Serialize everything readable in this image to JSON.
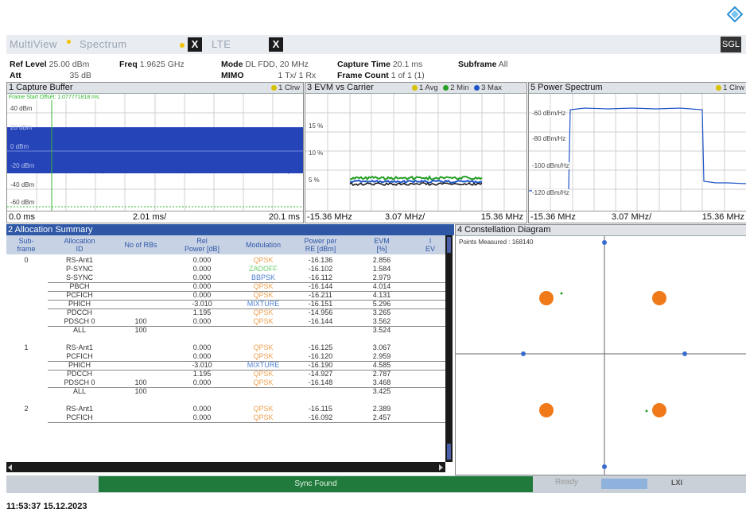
{
  "tabs": {
    "multiview": "MultiView",
    "spectrum": "Spectrum",
    "lte": "LTE",
    "close": "X",
    "mode": "SGL"
  },
  "info": {
    "ref_level_label": "Ref Level",
    "ref_level_value": "25.00 dBm",
    "freq_label": "Freq",
    "freq_value": "1.9625 GHz",
    "mode_label": "Mode",
    "mode_value": "DL FDD, 20 MHz",
    "capture_time_label": "Capture Time",
    "capture_time_value": "20.1 ms",
    "subframe_label": "Subframe",
    "subframe_value": "All",
    "att_label": "Att",
    "att_value": "35 dB",
    "mimo_label": "MIMO",
    "mimo_value": "1 Tx/ 1 Rx",
    "frame_count_label": "Frame Count",
    "frame_count_value": "1 of 1 (1)"
  },
  "capture": {
    "title": "1 Capture Buffer",
    "trace": "1 Clrw",
    "marker_note": "Frame Start Offset: 1.077771818 ms",
    "y_labels": [
      "40 dBm",
      "20 dBm",
      "0 dBm",
      "-20 dBm",
      "-40 dBm",
      "-60 dBm"
    ],
    "x_start": "0.0 ms",
    "x_div": "2.01 ms/",
    "x_end": "20.1 ms"
  },
  "evm": {
    "title": "3 EVM vs Carrier",
    "trace1": "1 Avg",
    "trace2": "2 Min",
    "trace3": "3 Max",
    "y_labels": [
      "15 %",
      "10 %",
      "5 %"
    ],
    "x_start": "-15.36 MHz",
    "x_div": "3.07 MHz/",
    "x_end": "15.36 MHz"
  },
  "power": {
    "title": "5 Power Spectrum",
    "trace": "1 Clrw",
    "y_labels": [
      "-60 dBm/Hz",
      "-80 dBm/Hz",
      "-100 dBm/Hz",
      "-120 dBm/Hz"
    ],
    "x_start": "-15.36 MHz",
    "x_div": "3.07 MHz/",
    "x_end": "15.36 MHz"
  },
  "alloc": {
    "title": "2 Allocation Summary",
    "headers": [
      "Sub-\nframe",
      "Allocation\nID",
      "No of RBs",
      "Rel\nPower [dB]",
      "Modulation",
      "Power per\nRE [dBm]",
      "EVM\n[%]",
      "I\nEV"
    ],
    "rows": [
      {
        "sf": "0",
        "id": "RS-Ant1",
        "rbs": "",
        "rel": "0.000",
        "mod": "QPSK",
        "pwr": "-16.136",
        "evm": "2.856"
      },
      {
        "sf": "",
        "id": "P-SYNC",
        "rbs": "",
        "rel": "0.000",
        "mod": "ZADOFF",
        "pwr": "-16.102",
        "evm": "1.584"
      },
      {
        "sf": "",
        "id": "S-SYNC",
        "rbs": "",
        "rel": "0.000",
        "mod": "BBPSK",
        "pwr": "-16.112",
        "evm": "2.979"
      },
      {
        "sf": "",
        "id": "PBCH",
        "rbs": "",
        "rel": "0.000",
        "mod": "QPSK",
        "pwr": "-16.144",
        "evm": "4.014"
      },
      {
        "sf": "",
        "id": "PCFICH",
        "rbs": "",
        "rel": "0.000",
        "mod": "QPSK",
        "pwr": "-16.211",
        "evm": "4.131"
      },
      {
        "sf": "",
        "id": "PHICH",
        "rbs": "",
        "rel": "-3.010",
        "mod": "MIXTURE",
        "pwr": "-16.151",
        "evm": "5.296"
      },
      {
        "sf": "",
        "id": "PDCCH",
        "rbs": "",
        "rel": "1.195",
        "mod": "QPSK",
        "pwr": "-14.956",
        "evm": "3.265"
      },
      {
        "sf": "",
        "id": "PDSCH 0",
        "rbs": "100",
        "rel": "0.000",
        "mod": "QPSK",
        "pwr": "-16.144",
        "evm": "3.562"
      },
      {
        "sf": "",
        "id": "ALL",
        "rbs": "100",
        "rel": "",
        "mod": "",
        "pwr": "",
        "evm": "3.524"
      },
      {
        "sf": "1",
        "id": "RS-Ant1",
        "rbs": "",
        "rel": "0.000",
        "mod": "QPSK",
        "pwr": "-16.125",
        "evm": "3.067"
      },
      {
        "sf": "",
        "id": "PCFICH",
        "rbs": "",
        "rel": "0.000",
        "mod": "QPSK",
        "pwr": "-16.120",
        "evm": "2.959"
      },
      {
        "sf": "",
        "id": "PHICH",
        "rbs": "",
        "rel": "-3.010",
        "mod": "MIXTURE",
        "pwr": "-16.190",
        "evm": "4.585"
      },
      {
        "sf": "",
        "id": "PDCCH",
        "rbs": "",
        "rel": "1.195",
        "mod": "QPSK",
        "pwr": "-14.927",
        "evm": "2.787"
      },
      {
        "sf": "",
        "id": "PDSCH 0",
        "rbs": "100",
        "rel": "0.000",
        "mod": "QPSK",
        "pwr": "-16.148",
        "evm": "3.468"
      },
      {
        "sf": "",
        "id": "ALL",
        "rbs": "100",
        "rel": "",
        "mod": "",
        "pwr": "",
        "evm": "3.425"
      },
      {
        "sf": "2",
        "id": "RS-Ant1",
        "rbs": "",
        "rel": "0.000",
        "mod": "QPSK",
        "pwr": "-16.115",
        "evm": "2.389"
      },
      {
        "sf": "",
        "id": "PCFICH",
        "rbs": "",
        "rel": "0.000",
        "mod": "QPSK",
        "pwr": "-16.092",
        "evm": "2.457"
      }
    ]
  },
  "constellation": {
    "title": "4 Constellation Diagram",
    "points_measured": "Points Measured : 168140"
  },
  "status": {
    "sync": "Sync Found",
    "ready": "Ready",
    "lxi": "LXI"
  },
  "timestamp": "11:53:37 15.12.2023",
  "colors": {
    "qpsk": "#f0a050",
    "zadoff": "#6ccf6c",
    "bbpsk": "#4f7fd0",
    "mixture": "#4f7fd0",
    "title_blue": "#2e57a6",
    "sync_green": "#1f7a3c",
    "trace_yellow": "#d8c200",
    "trace_green": "#25a025",
    "trace_blue": "#1f55c8"
  }
}
